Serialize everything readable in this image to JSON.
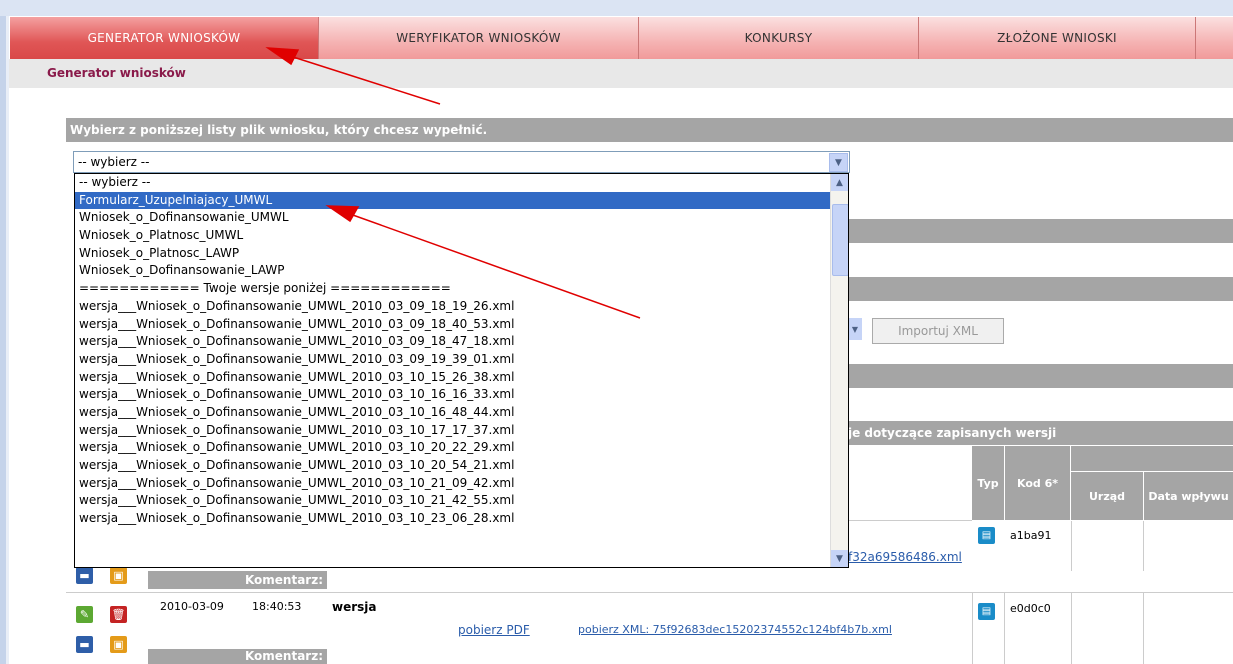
{
  "nav": {
    "tabs": [
      {
        "label": "GENERATOR WNIOSKÓW",
        "active": true
      },
      {
        "label": "WERYFIKATOR WNIOSKÓW",
        "active": false
      },
      {
        "label": "KONKURSY",
        "active": false
      },
      {
        "label": "ZŁOŻONE WNIOSKI",
        "active": false
      }
    ]
  },
  "breadcrumb": "Generator wniosków",
  "prompt": "Wybierz z poniższej listy plik wniosku, który chcesz wypełnić.",
  "select": {
    "value": "-- wybierz --",
    "options": [
      "-- wybierz --",
      "Formularz_Uzupelniajacy_UMWL",
      "Wniosek_o_Dofinansowanie_UMWL",
      "Wniosek_o_Platnosc_UMWL",
      "Wniosek_o_Platnosc_LAWP",
      "Wniosek_o_Dofinansowanie_LAWP",
      "============ Twoje wersje poniżej ============",
      "wersja___Wniosek_o_Dofinansowanie_UMWL_2010_03_09_18_19_26.xml",
      "wersja___Wniosek_o_Dofinansowanie_UMWL_2010_03_09_18_40_53.xml",
      "wersja___Wniosek_o_Dofinansowanie_UMWL_2010_03_09_18_47_18.xml",
      "wersja___Wniosek_o_Dofinansowanie_UMWL_2010_03_09_19_39_01.xml",
      "wersja___Wniosek_o_Dofinansowanie_UMWL_2010_03_10_15_26_38.xml",
      "wersja___Wniosek_o_Dofinansowanie_UMWL_2010_03_10_16_16_33.xml",
      "wersja___Wniosek_o_Dofinansowanie_UMWL_2010_03_10_16_48_44.xml",
      "wersja___Wniosek_o_Dofinansowanie_UMWL_2010_03_10_17_17_37.xml",
      "wersja___Wniosek_o_Dofinansowanie_UMWL_2010_03_10_20_22_29.xml",
      "wersja___Wniosek_o_Dofinansowanie_UMWL_2010_03_10_20_54_21.xml",
      "wersja___Wniosek_o_Dofinansowanie_UMWL_2010_03_10_21_09_42.xml",
      "wersja___Wniosek_o_Dofinansowanie_UMWL_2010_03_10_21_42_55.xml",
      "wersja___Wniosek_o_Dofinansowanie_UMWL_2010_03_10_23_06_28.xml"
    ],
    "selected_index": 1
  },
  "import_button": "Importuj XML",
  "versions_header": "je dotyczące zapisanych wersji",
  "table_headers": {
    "typ": "Typ",
    "kod": "Kod 6*",
    "urzad": "Urząd",
    "data": "Data wpływu"
  },
  "rows": [
    {
      "xml_link_partial": "f32a69586486.xml",
      "kod": "a1ba91",
      "comment_label": "Komentarz:"
    },
    {
      "date": "2010-03-09",
      "time": "18:40:53",
      "name": "wersja",
      "pdf_link": "pobierz PDF",
      "xml_link": "pobierz XML: 75f92683dec15202374552c124bf4b7b.xml",
      "kod": "e0d0c0",
      "comment_label": "Komentarz:"
    }
  ],
  "icons": {
    "doc": "document-icon",
    "edit": "pencil-icon",
    "delete": "trash-icon",
    "comment": "comment-icon",
    "lock": "lock-icon"
  },
  "colors": {
    "tab_active": "#d94848",
    "tab": "#f5b3b3",
    "selection": "#316ac5",
    "header_gray": "#a5a5a5",
    "breadcrumb": "#8a1a4a",
    "annotation_arrow": "#e00000"
  }
}
